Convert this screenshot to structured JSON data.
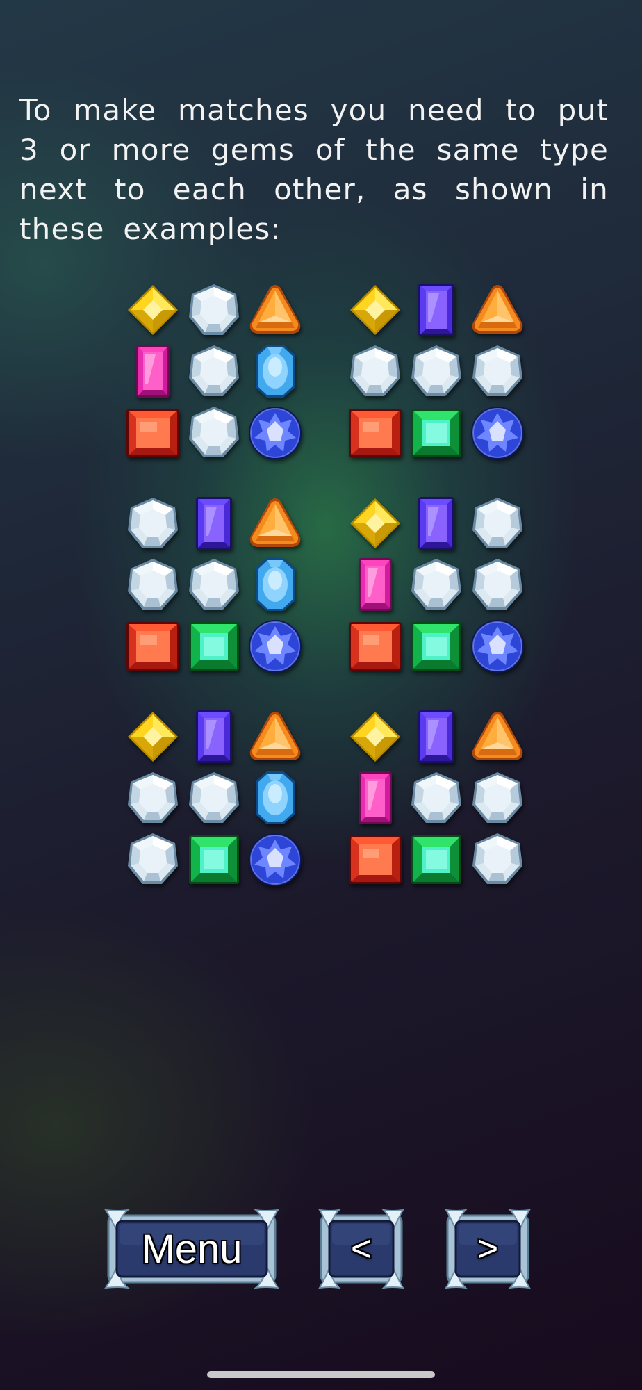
{
  "instructions": {
    "text": "To make matches you need to put 3 or more gems of the same type next to each other, as shown in these examples:"
  },
  "gem_legend": {
    "yellow": "yellow-diamond-gem",
    "white": "white-hexagon-gem",
    "orange": "orange-triangle-gem",
    "purple": "purple-rectangle-gem",
    "pink": "pink-rectangle-gem",
    "cyan": "light-blue-oval-gem",
    "red": "red-square-gem",
    "green": "green-square-gem",
    "blue": "blue-round-gem"
  },
  "colors": {
    "text": "#f2f2f2",
    "button_face": "#2a3868",
    "button_frame": "#c8dbe8"
  },
  "examples": [
    [
      [
        "yellow",
        "white",
        "orange"
      ],
      [
        "pink",
        "white",
        "cyan"
      ],
      [
        "red",
        "white",
        "blue"
      ]
    ],
    [
      [
        "yellow",
        "purple",
        "orange"
      ],
      [
        "white",
        "white",
        "white"
      ],
      [
        "red",
        "green",
        "blue"
      ]
    ],
    [
      [
        "white",
        "purple",
        "orange"
      ],
      [
        "white",
        "white",
        "cyan"
      ],
      [
        "red",
        "green",
        "blue"
      ]
    ],
    [
      [
        "yellow",
        "purple",
        "white"
      ],
      [
        "pink",
        "white",
        "white"
      ],
      [
        "red",
        "green",
        "blue"
      ]
    ],
    [
      [
        "yellow",
        "purple",
        "orange"
      ],
      [
        "white",
        "white",
        "cyan"
      ],
      [
        "white",
        "green",
        "blue"
      ]
    ],
    [
      [
        "yellow",
        "purple",
        "orange"
      ],
      [
        "pink",
        "white",
        "white"
      ],
      [
        "red",
        "green",
        "white"
      ]
    ]
  ],
  "buttons": {
    "menu": "Menu",
    "prev": "<",
    "next": ">"
  }
}
